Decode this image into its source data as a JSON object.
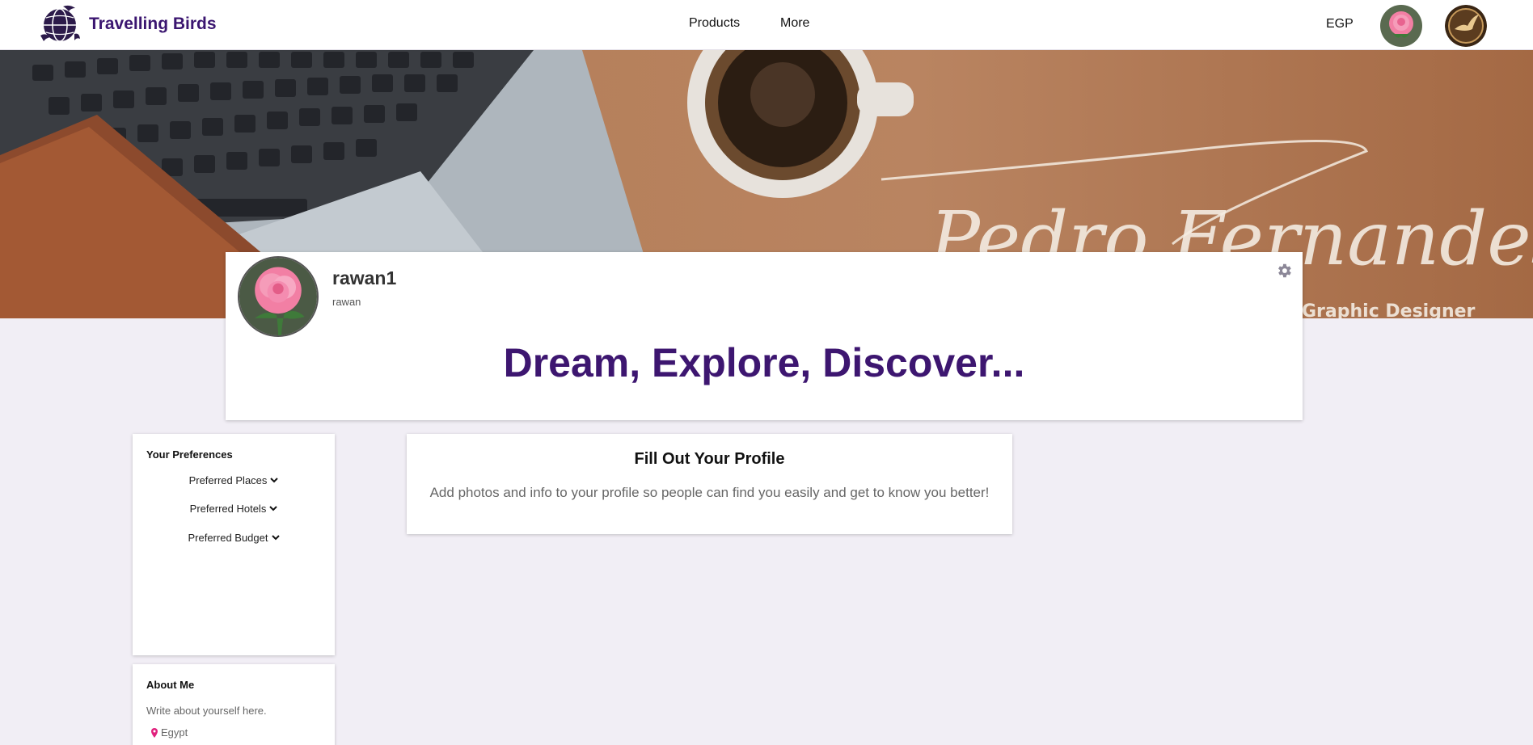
{
  "navbar": {
    "brand": "Travelling Birds",
    "links": [
      "Products",
      "More"
    ],
    "currency": "EGP"
  },
  "profile": {
    "username": "rawan1",
    "handle": "rawan",
    "tagline": "Dream, Explore, Discover..."
  },
  "banner": {
    "signature": "Pedro Fernandes",
    "subtitle": "Graphic Designer"
  },
  "preferences": {
    "title": "Your Preferences",
    "items": [
      "Preferred Places",
      "Preferred Hotels",
      "Preferred Budget"
    ]
  },
  "about": {
    "title": "About Me",
    "text": "Write about yourself here.",
    "location": "Egypt"
  },
  "fill_profile": {
    "title": "Fill Out Your Profile",
    "text": "Add photos and info to your profile so people can find you easily and get to know you better!"
  },
  "colors": {
    "brand": "#3b1670",
    "page_background": "#f1eef5",
    "tagline": "#3d1670"
  },
  "icons": [
    "globe-bird-logo",
    "rose-avatar",
    "bird-emblem-avatar",
    "gear-icon",
    "chevron-down-icon",
    "map-pin-icon"
  ]
}
